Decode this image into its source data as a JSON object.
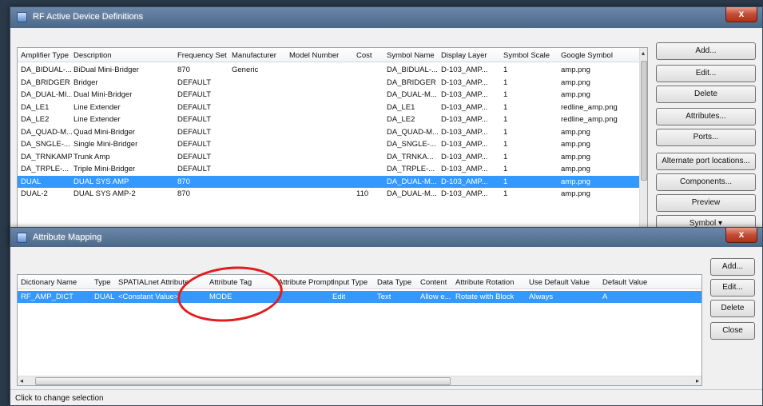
{
  "window1": {
    "title": "RF Active Device Definitions",
    "close": "x",
    "columns": [
      "Amplifier Type",
      "Description",
      "Frequency Set",
      "Manufacturer",
      "Model Number",
      "Cost",
      "Symbol Name",
      "Display Layer",
      "Symbol Scale",
      "Google Symbol"
    ],
    "rows": [
      [
        "DA_BIDUAL-...",
        "BiDual Mini-Bridger",
        "870",
        "Generic",
        "",
        "",
        "DA_BIDUAL-...",
        "D-103_AMP...",
        "1",
        "amp.png"
      ],
      [
        "DA_BRIDGER",
        "Bridger",
        "DEFAULT",
        "",
        "",
        "",
        "DA_BRIDGER",
        "D-103_AMP...",
        "1",
        "amp.png"
      ],
      [
        "DA_DUAL-MI...",
        "Dual Mini-Bridger",
        "DEFAULT",
        "",
        "",
        "",
        "DA_DUAL-M...",
        "D-103_AMP...",
        "1",
        "amp.png"
      ],
      [
        "DA_LE1",
        "Line Extender",
        "DEFAULT",
        "",
        "",
        "",
        "DA_LE1",
        "D-103_AMP...",
        "1",
        "redline_amp.png"
      ],
      [
        "DA_LE2",
        "Line Extender",
        "DEFAULT",
        "",
        "",
        "",
        "DA_LE2",
        "D-103_AMP...",
        "1",
        "redline_amp.png"
      ],
      [
        "DA_QUAD-M...",
        "Quad Mini-Bridger",
        "DEFAULT",
        "",
        "",
        "",
        "DA_QUAD-M...",
        "D-103_AMP...",
        "1",
        "amp.png"
      ],
      [
        "DA_SNGLE-...",
        "Single Mini-Bridger",
        "DEFAULT",
        "",
        "",
        "",
        "DA_SNGLE-...",
        "D-103_AMP...",
        "1",
        "amp.png"
      ],
      [
        "DA_TRNKAMP",
        "Trunk Amp",
        "DEFAULT",
        "",
        "",
        "",
        "DA_TRNKA...",
        "D-103_AMP...",
        "1",
        "amp.png"
      ],
      [
        "DA_TRPLE-...",
        "Triple Mini-Bridger",
        "DEFAULT",
        "",
        "",
        "",
        "DA_TRPLE-...",
        "D-103_AMP...",
        "1",
        "amp.png"
      ],
      [
        "DUAL",
        "DUAL SYS AMP",
        "870",
        "",
        "",
        "",
        "DA_DUAL-M...",
        "D-103_AMP...",
        "1",
        "amp.png"
      ],
      [
        "DUAL-2",
        "DUAL SYS AMP-2",
        "870",
        "",
        "",
        "110",
        "DA_DUAL-M...",
        "D-103_AMP...",
        "1",
        "amp.png"
      ]
    ],
    "selected_row": 9,
    "buttons": [
      "Add...",
      "Edit...",
      "Delete",
      "Attributes...",
      "Ports...",
      "Alternate port locations...",
      "Components...",
      "Preview",
      "Symbol ▾"
    ]
  },
  "window2": {
    "title": "Attribute Mapping",
    "close": "x",
    "columns": [
      "Dictionary Name",
      "Type",
      "SPATIALnet Attribute",
      "Attribute Tag",
      "Attribute Prompt",
      "Input Type",
      "Data Type",
      "Content",
      "Attribute Rotation",
      "Use Default Value",
      "Default Value"
    ],
    "rows": [
      [
        "RF_AMP_DICT",
        "DUAL",
        "<Constant Value>",
        "MODE",
        "",
        "Edit",
        "Text",
        "Allow e...",
        "Rotate with Block",
        "Always",
        "A"
      ]
    ],
    "selected_row": 0,
    "buttons": [
      "Add...",
      "Edit...",
      "Delete",
      "Close"
    ],
    "status": "Click to change selection"
  },
  "colors": {
    "selection": "#3399ff",
    "annotation": "#e11d1d"
  }
}
